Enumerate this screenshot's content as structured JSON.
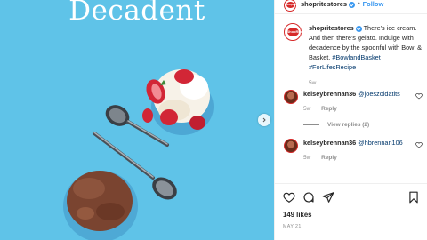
{
  "photo": {
    "headline": "Decadent",
    "next_icon": "chevron-right-icon",
    "colors": {
      "background": "#5fc3e8",
      "strawberry": "#d22636",
      "vanilla": "#f7f2e8",
      "chocolate": "#7a4430",
      "bowl": "#3e8fc2"
    }
  },
  "header": {
    "username": "shopritestores",
    "follow_label": "Follow",
    "dot": "•",
    "avatar_text": "ShopRite"
  },
  "caption": {
    "username": "shopritestores",
    "text": "There's ice cream. And then there's gelato. Indulge with decadence by the spoonful with Bowl & Basket.",
    "hashtags": "#BowlandBasket #ForLifesRecipe",
    "time": "5w"
  },
  "comments": [
    {
      "username": "kelseybrennan36",
      "mention": "@joeszoldatits",
      "time": "5w",
      "reply_label": "Reply"
    },
    {
      "username": "kelseybrennan36",
      "mention": "@hbrennan106",
      "time": "5w",
      "reply_label": "Reply"
    }
  ],
  "view_replies": "View replies (2)",
  "actions": {
    "icons": [
      "heart-icon",
      "comment-icon",
      "share-icon",
      "bookmark-icon"
    ],
    "likes": "149 likes",
    "date": "MAY 21"
  },
  "accent": {
    "link": "#3897f0",
    "hashtag": "#00376b",
    "muted": "#8e8e8e"
  }
}
